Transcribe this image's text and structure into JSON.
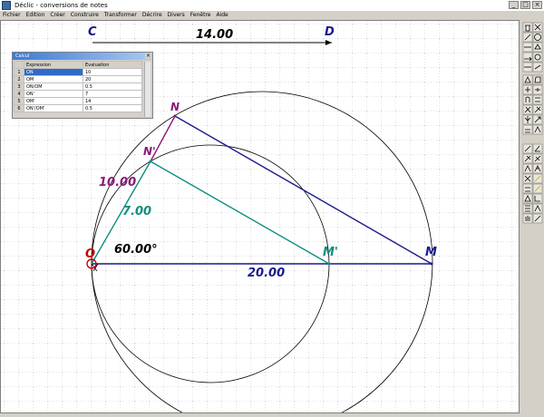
{
  "window": {
    "title": "Déclic - conversions de notes",
    "buttons": [
      "_",
      "□",
      "×"
    ]
  },
  "menu": [
    "Fichier",
    "Edition",
    "Créer",
    "Construire",
    "Transformer",
    "Décrire",
    "Divers",
    "Fenêtre",
    "Aide"
  ],
  "calc_window": {
    "title": "Calcul",
    "close": "×",
    "headers": [
      "",
      "Expression",
      "Evaluation"
    ],
    "rows": [
      {
        "n": "1",
        "expr": "ON",
        "val": "10"
      },
      {
        "n": "2",
        "expr": "OM",
        "val": "20"
      },
      {
        "n": "3",
        "expr": "ON/OM",
        "val": "0.5"
      },
      {
        "n": "4",
        "expr": "ON'",
        "val": "7"
      },
      {
        "n": "5",
        "expr": "OM'",
        "val": "14"
      },
      {
        "n": "6",
        "expr": "ON'/OM'",
        "val": "0.5"
      }
    ]
  },
  "figure": {
    "points": {
      "C": "C",
      "D": "D",
      "O": "O",
      "N": "N",
      "N_prime": "N'",
      "M": "M",
      "M_prime": "M'"
    },
    "labels": {
      "CD": "14.00",
      "ON": "10.00",
      "ON_prime": "7.00",
      "angle": "60.00°",
      "OM": "20.00"
    },
    "colors": {
      "navy": "#1a1a8c",
      "teal": "#0f8f80",
      "purple": "#8b1a7a",
      "red": "#cc0000",
      "black": "#000000"
    }
  }
}
